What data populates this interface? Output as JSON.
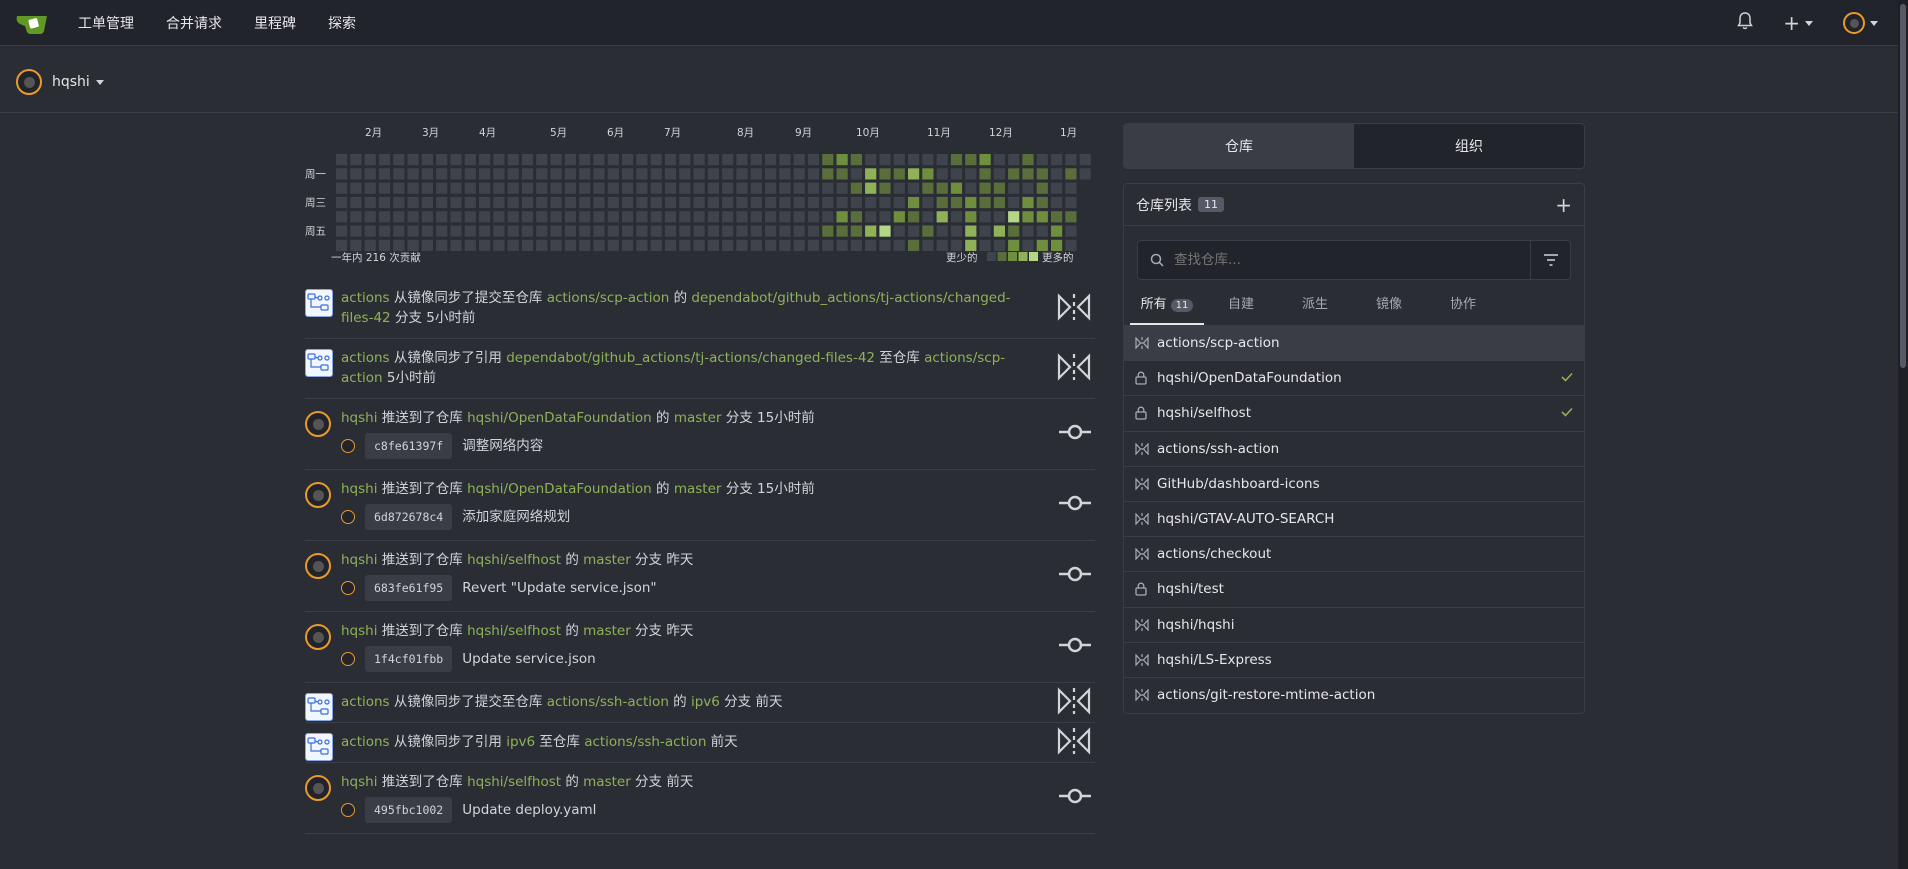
{
  "nav": {
    "items": [
      "工单管理",
      "合并请求",
      "里程碑",
      "探索"
    ]
  },
  "user": {
    "name": "hqshi"
  },
  "heatmap": {
    "months": [
      "2月",
      "3月",
      "4月",
      "5月",
      "6月",
      "7月",
      "8月",
      "9月",
      "10月",
      "11月",
      "12月",
      "1月"
    ],
    "days": [
      "周一",
      "周三",
      "周五"
    ],
    "summary": "一年内 216 次贡献",
    "less": "更少的",
    "more": "更多的",
    "colors": [
      "#3f434c",
      "#5a6e3b",
      "#6f8f3f",
      "#8fb157",
      "#b4d686"
    ]
  },
  "feed": [
    {
      "kind": "mirror",
      "avatar": "gitea-bot",
      "parts": [
        {
          "t": "actions",
          "l": true
        },
        {
          "t": " 从镜像同步了提交至仓库 "
        },
        {
          "t": "actions/scp-action",
          "l": true
        },
        {
          "t": " 的 "
        },
        {
          "t": "dependabot/github_actions/tj-actions/changed-files-42",
          "l": true
        },
        {
          "t": " 分支 5小时前"
        }
      ]
    },
    {
      "kind": "mirror",
      "avatar": "gitea-bot",
      "parts": [
        {
          "t": "actions",
          "l": true
        },
        {
          "t": " 从镜像同步了引用 "
        },
        {
          "t": "dependabot/github_actions/tj-actions/changed-files-42",
          "l": true
        },
        {
          "t": " 至仓库 "
        },
        {
          "t": "actions/scp-action",
          "l": true
        },
        {
          "t": " 5小时前"
        }
      ]
    },
    {
      "kind": "push",
      "avatar": "user",
      "parts": [
        {
          "t": "hqshi",
          "l": true
        },
        {
          "t": " 推送到了仓库 "
        },
        {
          "t": "hqshi/OpenDataFoundation",
          "l": true
        },
        {
          "t": " 的 "
        },
        {
          "t": "master",
          "l": true
        },
        {
          "t": " 分支 15小时前"
        }
      ],
      "commit": {
        "sha": "c8fe61397f",
        "msg": "调整网络内容"
      }
    },
    {
      "kind": "push",
      "avatar": "user",
      "parts": [
        {
          "t": "hqshi",
          "l": true
        },
        {
          "t": " 推送到了仓库 "
        },
        {
          "t": "hqshi/OpenDataFoundation",
          "l": true
        },
        {
          "t": " 的 "
        },
        {
          "t": "master",
          "l": true
        },
        {
          "t": " 分支 15小时前"
        }
      ],
      "commit": {
        "sha": "6d872678c4",
        "msg": "添加家庭网络规划"
      }
    },
    {
      "kind": "push",
      "avatar": "user",
      "parts": [
        {
          "t": "hqshi",
          "l": true
        },
        {
          "t": " 推送到了仓库 "
        },
        {
          "t": "hqshi/selfhost",
          "l": true
        },
        {
          "t": " 的 "
        },
        {
          "t": "master",
          "l": true
        },
        {
          "t": " 分支 昨天"
        }
      ],
      "commit": {
        "sha": "683fe61f95",
        "msg": "Revert \"Update service.json\""
      }
    },
    {
      "kind": "push",
      "avatar": "user",
      "parts": [
        {
          "t": "hqshi",
          "l": true
        },
        {
          "t": " 推送到了仓库 "
        },
        {
          "t": "hqshi/selfhost",
          "l": true
        },
        {
          "t": " 的 "
        },
        {
          "t": "master",
          "l": true
        },
        {
          "t": " 分支 昨天"
        }
      ],
      "commit": {
        "sha": "1f4cf01fbb",
        "msg": "Update service.json"
      }
    },
    {
      "kind": "mirror",
      "avatar": "gitea-bot",
      "parts": [
        {
          "t": "actions",
          "l": true
        },
        {
          "t": " 从镜像同步了提交至仓库 "
        },
        {
          "t": "actions/ssh-action",
          "l": true
        },
        {
          "t": " 的 "
        },
        {
          "t": "ipv6",
          "l": true
        },
        {
          "t": " 分支 前天"
        }
      ]
    },
    {
      "kind": "mirror",
      "avatar": "gitea-bot",
      "parts": [
        {
          "t": "actions",
          "l": true
        },
        {
          "t": " 从镜像同步了引用 "
        },
        {
          "t": "ipv6",
          "l": true
        },
        {
          "t": " 至仓库 "
        },
        {
          "t": "actions/ssh-action",
          "l": true
        },
        {
          "t": " 前天"
        }
      ]
    },
    {
      "kind": "push",
      "avatar": "user",
      "parts": [
        {
          "t": "hqshi",
          "l": true
        },
        {
          "t": " 推送到了仓库 "
        },
        {
          "t": "hqshi/selfhost",
          "l": true
        },
        {
          "t": " 的 "
        },
        {
          "t": "master",
          "l": true
        },
        {
          "t": " 分支 前天"
        }
      ],
      "commit": {
        "sha": "495fbc1002",
        "msg": "Update deploy.yaml"
      }
    }
  ],
  "right": {
    "tab_repos": "仓库",
    "tab_orgs": "组织",
    "list_title": "仓库列表",
    "count": "11",
    "search_placeholder": "查找仓库...",
    "filters": [
      "所有",
      "自建",
      "派生",
      "镜像",
      "协作"
    ],
    "all_count": "11",
    "repos": [
      {
        "name": "actions/scp-action",
        "icon": "mirror-icon",
        "check": false,
        "selected": true
      },
      {
        "name": "hqshi/OpenDataFoundation",
        "icon": "lock-icon",
        "check": true
      },
      {
        "name": "hqshi/selfhost",
        "icon": "lock-icon",
        "check": true
      },
      {
        "name": "actions/ssh-action",
        "icon": "mirror-icon",
        "check": false
      },
      {
        "name": "GitHub/dashboard-icons",
        "icon": "mirror-icon",
        "check": false
      },
      {
        "name": "hqshi/GTAV-AUTO-SEARCH",
        "icon": "mirror-icon",
        "check": false
      },
      {
        "name": "actions/checkout",
        "icon": "mirror-icon",
        "check": false
      },
      {
        "name": "hqshi/test",
        "icon": "lock-icon",
        "check": false
      },
      {
        "name": "hqshi/hqshi",
        "icon": "mirror-icon",
        "check": false
      },
      {
        "name": "hqshi/LS-Express",
        "icon": "mirror-icon",
        "check": false
      },
      {
        "name": "actions/git-restore-mtime-action",
        "icon": "mirror-icon",
        "check": false
      }
    ]
  }
}
